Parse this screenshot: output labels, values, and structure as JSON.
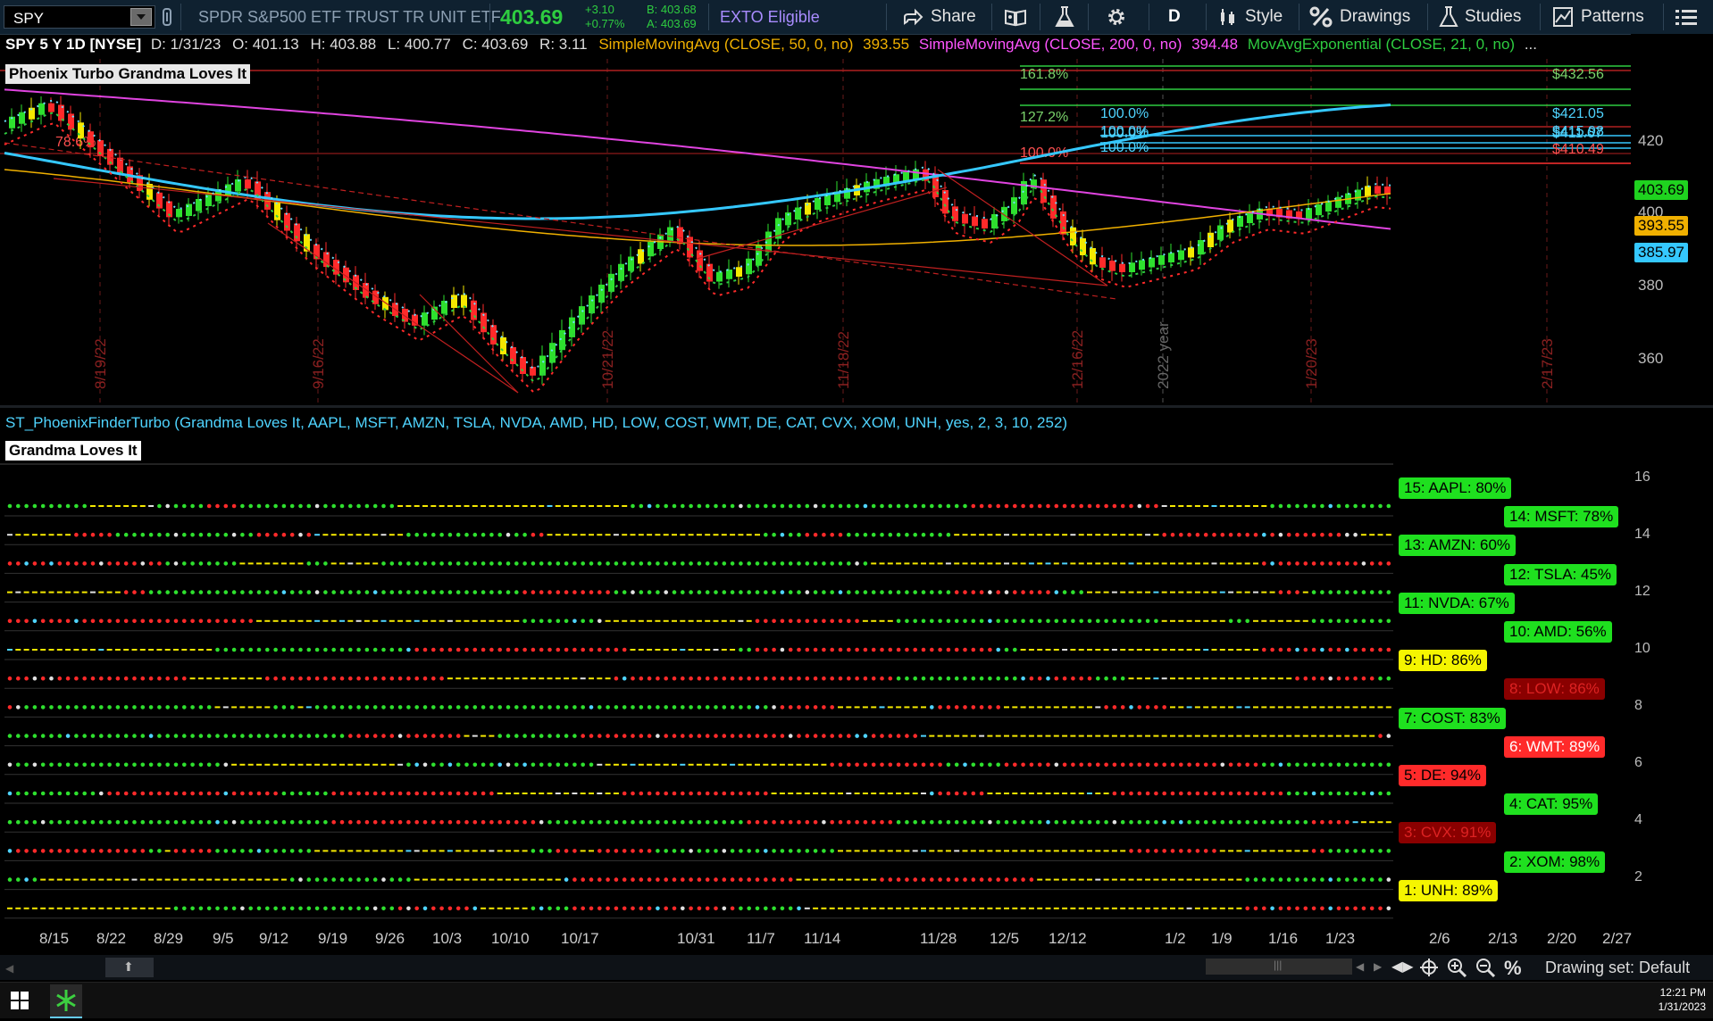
{
  "toolbar": {
    "symbol": "SPY",
    "description": "SPDR S&P500 ETF TRUST TR UNIT ETF",
    "last": "403.69",
    "change": "+3.10",
    "change_pct": "+0.77%",
    "bid": "B: 403.68",
    "ask": "A: 403.69",
    "exto": "EXTO Eligible",
    "share": "Share",
    "period": "D",
    "style": "Style",
    "drawings": "Drawings",
    "studies": "Studies",
    "patterns": "Patterns",
    "colors": {
      "up": "#2ecc40",
      "exto": "#a98cff"
    }
  },
  "info": {
    "header": "SPY 5 Y 1D [NYSE]",
    "d": "D: 1/31/23",
    "o": "O: 401.13",
    "h": "H: 403.88",
    "l": "L: 400.77",
    "c": "C: 403.69",
    "r": "R: 3.11",
    "sma50": "SimpleMovingAvg (CLOSE, 50, 0, no)",
    "sma50_val": "393.55",
    "sma200": "SimpleMovingAvg (CLOSE, 200, 0, no)",
    "sma200_val": "394.48",
    "ema21": "MovAvgExponential (CLOSE, 21, 0, no)",
    "more": "..."
  },
  "chart": {
    "label": "Phoenix Turbo Grandma Loves It",
    "fib_labels": [
      {
        "text": "161.8%",
        "color": "#7ad36b"
      },
      {
        "text": "127.2%",
        "color": "#7ad36b"
      },
      {
        "text": "100.0%",
        "color": "#ff5050"
      },
      {
        "text": "78.6%",
        "color": "#ff5050"
      },
      {
        "text": "100.0%",
        "color": "#4fd4ff"
      },
      {
        "text": "100.0%",
        "color": "#4fd4ff"
      },
      {
        "text": "100.0%",
        "color": "#4fd4ff"
      },
      {
        "text": "100.0%",
        "color": "#4fd4ff"
      }
    ],
    "right_prices": [
      {
        "text": "$432.56",
        "color": "#7ad36b"
      },
      {
        "text": "$421.05",
        "color": "#4fd4ff"
      },
      {
        "text": "$415.98",
        "color": "#4fd4ff"
      },
      {
        "text": "$411.67",
        "color": "#4fd4ff"
      },
      {
        "text": "$410.49",
        "color": "#ff5050"
      }
    ],
    "vertical_dates": [
      "8/19/22",
      "9/16/22",
      "10/21/22",
      "11/18/22",
      "12/16/22",
      "2022 year",
      "1/20/23",
      "2/17/23"
    ],
    "price_ticks": [
      "420",
      "400",
      "380",
      "360"
    ],
    "price_labels": [
      {
        "text": "403.69",
        "bg": "#1fd21f",
        "fg": "#000"
      },
      {
        "text": "393.55",
        "bg": "#f0b000",
        "fg": "#000"
      },
      {
        "text": "385.97",
        "bg": "#35c8ff",
        "fg": "#000"
      }
    ]
  },
  "indicator": {
    "title": "ST_PhoenixFinderTurbo (Grandma Loves It, AAPL, MSFT, AMZN, TSLA, NVDA, AMD, HD, LOW, COST, WMT, DE, CAT, CVX, XOM, UNH, yes, 2, 3, 10, 252)",
    "label": "Grandma Loves It",
    "y_ticks": [
      "16",
      "14",
      "12",
      "10",
      "8",
      "6",
      "4",
      "2"
    ],
    "tags": [
      {
        "text": "15: AAPL: 80%",
        "bg": "#1fe01f",
        "fg": "#000",
        "col": 0
      },
      {
        "text": "14: MSFT: 78%",
        "bg": "#1fe01f",
        "fg": "#000",
        "col": 1
      },
      {
        "text": "13: AMZN: 60%",
        "bg": "#1fe01f",
        "fg": "#000",
        "col": 0
      },
      {
        "text": "12: TSLA: 45%",
        "bg": "#1fe01f",
        "fg": "#000",
        "col": 1
      },
      {
        "text": "11: NVDA: 67%",
        "bg": "#1fe01f",
        "fg": "#000",
        "col": 0
      },
      {
        "text": "10: AMD: 56%",
        "bg": "#1fe01f",
        "fg": "#000",
        "col": 1
      },
      {
        "text": "9: HD: 86%",
        "bg": "#f5f500",
        "fg": "#000",
        "col": 0
      },
      {
        "text": "8: LOW: 86%",
        "bg": "#8a0000",
        "fg": "#d22",
        "col": 1
      },
      {
        "text": "7: COST: 83%",
        "bg": "#1fe01f",
        "fg": "#000",
        "col": 0
      },
      {
        "text": "6: WMT: 89%",
        "bg": "#ff2a2a",
        "fg": "#fff",
        "col": 1
      },
      {
        "text": "5: DE: 94%",
        "bg": "#ff2a2a",
        "fg": "#000",
        "col": 0
      },
      {
        "text": "4: CAT: 95%",
        "bg": "#1fe01f",
        "fg": "#000",
        "col": 1
      },
      {
        "text": "3: CVX: 91%",
        "bg": "#8a0000",
        "fg": "#d22",
        "col": 0
      },
      {
        "text": "2: XOM: 98%",
        "bg": "#1fe01f",
        "fg": "#000",
        "col": 1
      },
      {
        "text": "1: UNH: 89%",
        "bg": "#f5f500",
        "fg": "#000",
        "col": 0
      }
    ]
  },
  "date_axis": [
    "8/15",
    "8/22",
    "8/29",
    "9/5",
    "9/12",
    "9/19",
    "9/26",
    "10/3",
    "10/10",
    "10/17",
    "10/31",
    "11/7",
    "11/14",
    "11/28",
    "12/5",
    "12/12",
    "1/2",
    "1/9",
    "1/16",
    "1/23",
    "2/6",
    "2/13",
    "2/20",
    "2/27"
  ],
  "status": {
    "drawing_set": "Drawing set: Default",
    "time": "12:21 PM",
    "date": "1/31/2023"
  }
}
